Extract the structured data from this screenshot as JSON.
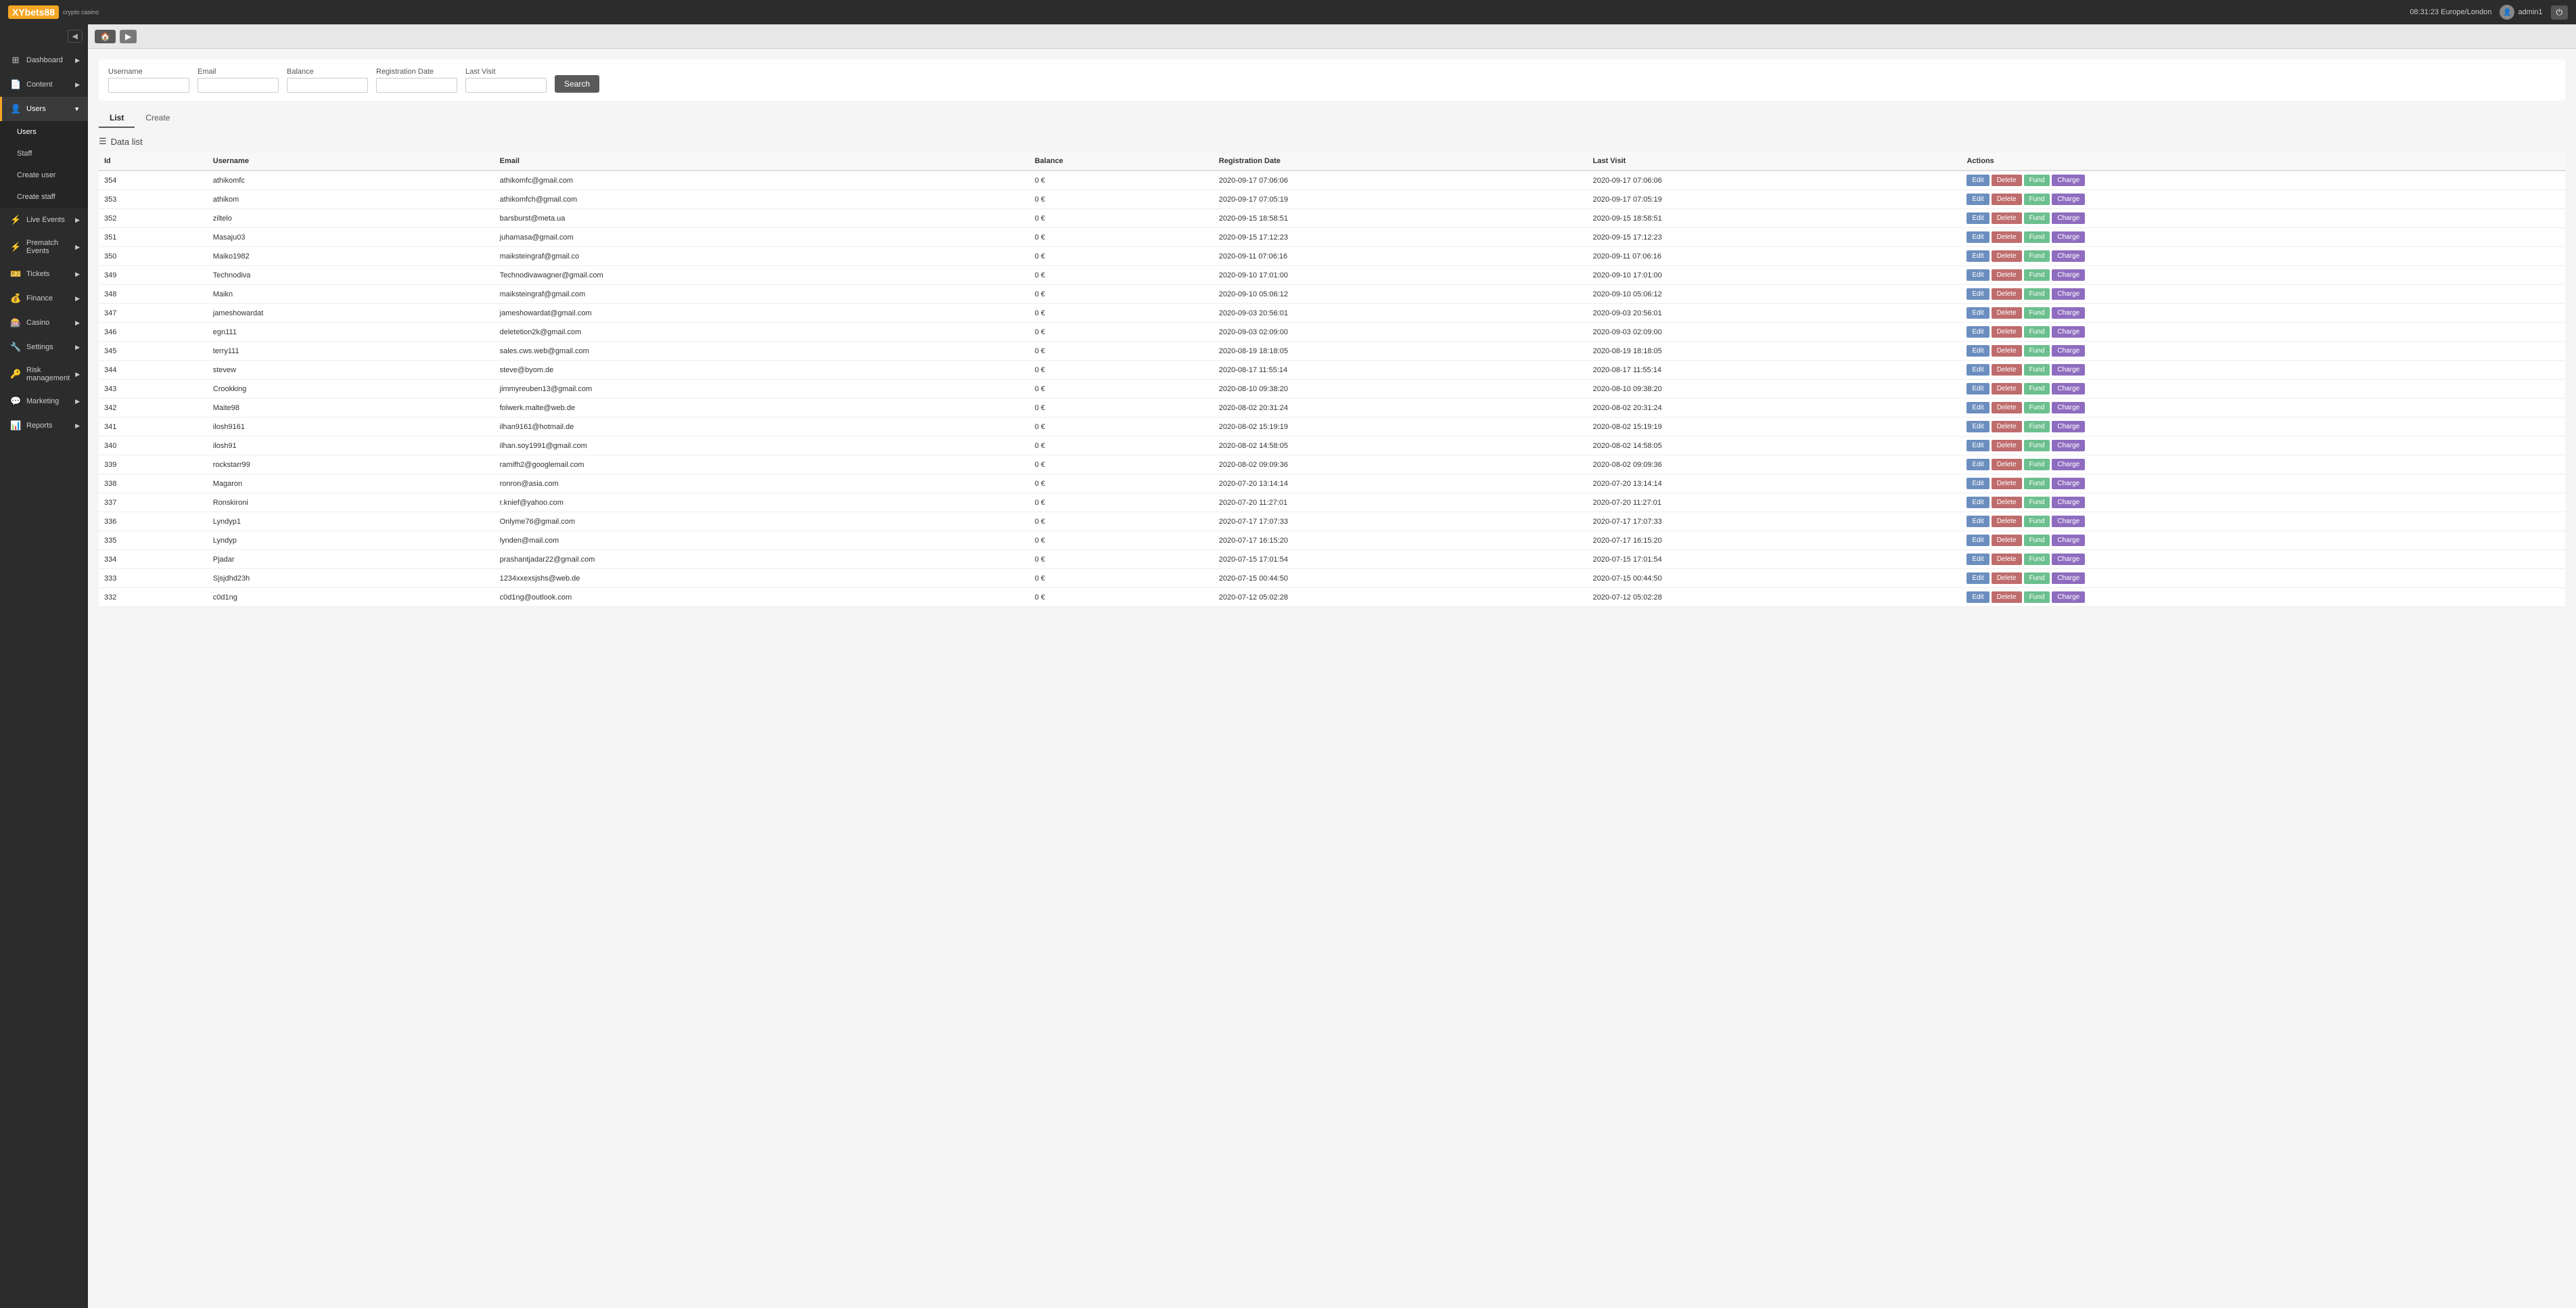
{
  "topbar": {
    "logo_text": "XYbets88",
    "logo_sub": "crypto casino",
    "time": "08:31:23 Europe/London",
    "username": "admin1"
  },
  "sidebar": {
    "toggle_label": "◀",
    "items": [
      {
        "id": "dashboard",
        "label": "Dashboard",
        "icon": "⊞",
        "has_arrow": true
      },
      {
        "id": "content",
        "label": "Content",
        "icon": "📄",
        "has_arrow": true
      },
      {
        "id": "users",
        "label": "Users",
        "icon": "👤",
        "has_arrow": true,
        "active": true
      },
      {
        "id": "live-events",
        "label": "Live Events",
        "icon": "⚡",
        "has_arrow": true
      },
      {
        "id": "prematch-events",
        "label": "Prematch Events",
        "icon": "⚡",
        "has_arrow": true
      },
      {
        "id": "tickets",
        "label": "Tickets",
        "icon": "🎫",
        "has_arrow": true
      },
      {
        "id": "finance",
        "label": "Finance",
        "icon": "💰",
        "has_arrow": true
      },
      {
        "id": "casino",
        "label": "Casino",
        "icon": "🎰",
        "has_arrow": true
      },
      {
        "id": "settings",
        "label": "Settings",
        "icon": "🔧",
        "has_arrow": true
      },
      {
        "id": "risk-management",
        "label": "Risk management",
        "icon": "🔑",
        "has_arrow": true
      },
      {
        "id": "marketing",
        "label": "Marketing",
        "icon": "💬",
        "has_arrow": true
      },
      {
        "id": "reports",
        "label": "Reports",
        "icon": "📊",
        "has_arrow": true
      }
    ],
    "sub_items": [
      {
        "id": "users-sub",
        "label": "Users",
        "active": true
      },
      {
        "id": "staff-sub",
        "label": "Staff"
      },
      {
        "id": "create-user",
        "label": "Create user",
        "active_sub": true
      },
      {
        "id": "create-staff",
        "label": "Create staff"
      }
    ]
  },
  "search": {
    "fields": [
      {
        "id": "username",
        "label": "Username",
        "placeholder": ""
      },
      {
        "id": "email",
        "label": "Email",
        "placeholder": ""
      },
      {
        "id": "balance",
        "label": "Balance",
        "placeholder": ""
      },
      {
        "id": "registration-date",
        "label": "Registration Date",
        "placeholder": ""
      },
      {
        "id": "last-visit",
        "label": "Last Visit",
        "placeholder": ""
      }
    ],
    "button_label": "Search"
  },
  "tabs": [
    {
      "id": "list",
      "label": "List",
      "active": true
    },
    {
      "id": "create",
      "label": "Create"
    }
  ],
  "data_list": {
    "header": "Data list",
    "columns": [
      "Id",
      "Username",
      "Email",
      "Balance",
      "Registration Date",
      "Last Visit",
      "Actions"
    ],
    "action_labels": {
      "edit": "Edit",
      "delete": "Delete",
      "fund": "Fund",
      "charge": "Charge"
    },
    "rows": [
      {
        "id": 354,
        "username": "athikomfc",
        "email": "athikomfc@gmail.com",
        "balance": "0 €",
        "reg_date": "2020-09-17 07:06:06",
        "last_visit": "2020-09-17 07:06:06"
      },
      {
        "id": 353,
        "username": "athikom",
        "email": "athikomfch@gmail.com",
        "balance": "0 €",
        "reg_date": "2020-09-17 07:05:19",
        "last_visit": "2020-09-17 07:05:19"
      },
      {
        "id": 352,
        "username": "ziltelo",
        "email": "barsburst@meta.ua",
        "balance": "0 €",
        "reg_date": "2020-09-15 18:58:51",
        "last_visit": "2020-09-15 18:58:51"
      },
      {
        "id": 351,
        "username": "Masaju03",
        "email": "juhamasa@gmail.com",
        "balance": "0 €",
        "reg_date": "2020-09-15 17:12:23",
        "last_visit": "2020-09-15 17:12:23"
      },
      {
        "id": 350,
        "username": "Maiko1982",
        "email": "maiksteingraf@gmail.co",
        "balance": "0 €",
        "reg_date": "2020-09-11 07:06:16",
        "last_visit": "2020-09-11 07:06:16"
      },
      {
        "id": 349,
        "username": "Technodiva",
        "email": "Technodivawagner@gmail.com",
        "balance": "0 €",
        "reg_date": "2020-09-10 17:01:00",
        "last_visit": "2020-09-10 17:01:00"
      },
      {
        "id": 348,
        "username": "Maikn",
        "email": "maiksteingraf@gmail.com",
        "balance": "0 €",
        "reg_date": "2020-09-10 05:06:12",
        "last_visit": "2020-09-10 05:06:12"
      },
      {
        "id": 347,
        "username": "jameshowardat",
        "email": "jameshowardat@gmail.com",
        "balance": "0 €",
        "reg_date": "2020-09-03 20:56:01",
        "last_visit": "2020-09-03 20:56:01"
      },
      {
        "id": 346,
        "username": "egn111",
        "email": "deletetion2k@gmail.com",
        "balance": "0 €",
        "reg_date": "2020-09-03 02:09:00",
        "last_visit": "2020-09-03 02:09:00"
      },
      {
        "id": 345,
        "username": "terry111",
        "email": "sales.cws.web@gmail.com",
        "balance": "0 €",
        "reg_date": "2020-08-19 18:18:05",
        "last_visit": "2020-08-19 18:18:05"
      },
      {
        "id": 344,
        "username": "stevew",
        "email": "steve@byom.de",
        "balance": "0 €",
        "reg_date": "2020-08-17 11:55:14",
        "last_visit": "2020-08-17 11:55:14"
      },
      {
        "id": 343,
        "username": "Crookking",
        "email": "jimmyreuben13@gmail.com",
        "balance": "0 €",
        "reg_date": "2020-08-10 09:38:20",
        "last_visit": "2020-08-10 09:38:20"
      },
      {
        "id": 342,
        "username": "Maite98",
        "email": "folwerk.malte@web.de",
        "balance": "0 €",
        "reg_date": "2020-08-02 20:31:24",
        "last_visit": "2020-08-02 20:31:24"
      },
      {
        "id": 341,
        "username": "ilosh9161",
        "email": "ilhan9161@hotmail.de",
        "balance": "0 €",
        "reg_date": "2020-08-02 15:19:19",
        "last_visit": "2020-08-02 15:19:19"
      },
      {
        "id": 340,
        "username": "ilosh91",
        "email": "ilhan.soy1991@gmail.com",
        "balance": "0 €",
        "reg_date": "2020-08-02 14:58:05",
        "last_visit": "2020-08-02 14:58:05"
      },
      {
        "id": 339,
        "username": "rockstarr99",
        "email": "ramifh2@googlemail.com",
        "balance": "0 €",
        "reg_date": "2020-08-02 09:09:36",
        "last_visit": "2020-08-02 09:09:36"
      },
      {
        "id": 338,
        "username": "Magaron",
        "email": "ronron@asia.com",
        "balance": "0 €",
        "reg_date": "2020-07-20 13:14:14",
        "last_visit": "2020-07-20 13:14:14"
      },
      {
        "id": 337,
        "username": "Ronskironi",
        "email": "r.knief@yahoo.com",
        "balance": "0 €",
        "reg_date": "2020-07-20 11:27:01",
        "last_visit": "2020-07-20 11:27:01"
      },
      {
        "id": 336,
        "username": "Lyndyp1",
        "email": "Onlyme76@gmail.com",
        "balance": "0 €",
        "reg_date": "2020-07-17 17:07:33",
        "last_visit": "2020-07-17 17:07:33"
      },
      {
        "id": 335,
        "username": "Lyndyp",
        "email": "lynden@mail.com",
        "balance": "0 €",
        "reg_date": "2020-07-17 16:15:20",
        "last_visit": "2020-07-17 16:15:20"
      },
      {
        "id": 334,
        "username": "Pjadar",
        "email": "prashantjadar22@gmail.com",
        "balance": "0 €",
        "reg_date": "2020-07-15 17:01:54",
        "last_visit": "2020-07-15 17:01:54"
      },
      {
        "id": 333,
        "username": "Sjsjdhd23h",
        "email": "1234xxexsjshs@web.de",
        "balance": "0 €",
        "reg_date": "2020-07-15 00:44:50",
        "last_visit": "2020-07-15 00:44:50"
      },
      {
        "id": 332,
        "username": "c0d1ng",
        "email": "c0d1ng@outlook.com",
        "balance": "0 €",
        "reg_date": "2020-07-12 05:02:28",
        "last_visit": "2020-07-12 05:02:28"
      }
    ]
  }
}
